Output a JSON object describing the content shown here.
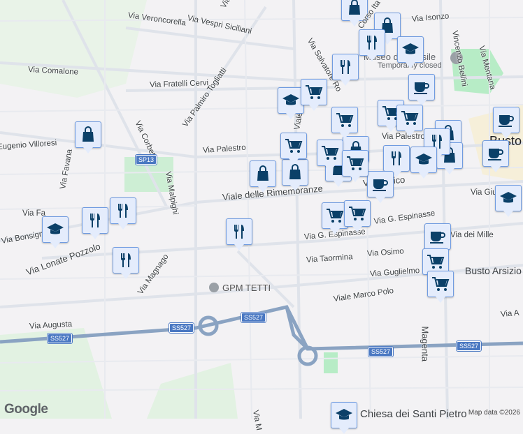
{
  "map": {
    "streets": [
      "Via Tolmino",
      "Via Vespri Siciliani",
      "Via Veroncorella",
      "Via Comalone",
      "Via Fratelli Cervi",
      "Via Palmiro Togliatti",
      "Via Corbetta",
      "Via Palestro",
      "Via Palestro",
      "SP13",
      "Via Favana",
      "Via Malpighi",
      "Viale delle Rimembranze",
      "Via Lonate Pozzolo",
      "Via Bonsignora",
      "Via Magnago",
      "Via G. Espinasse",
      "Via G. Espinasse",
      "Via Taormina",
      "Via Osimo",
      "Via Guglielmo P",
      "Viale Marco Polo",
      "Via Augusta",
      "SS527",
      "SS527",
      "SS527",
      "SS527",
      "Magenta",
      "Via Isonzo",
      "Vincenzo Bellini",
      "Via Mentana",
      "Via Salvatore Ro",
      "Corso Ita",
      "Viale Mo",
      "Via dei Mille",
      "Via Giu",
      "Eugenio Villoresi",
      "Via Fa",
      "Via M",
      "Via Pellico",
      "Via A"
    ],
    "places": {
      "museum": "Museo del Tessile",
      "museum_status": "Temporarily closed",
      "gpm": "GPM TETTI",
      "busto": "Busto Arsizio",
      "busto_top": "Busto",
      "church": "Chiesa dei Santi Pietro"
    },
    "marker_types": [
      "shopping-bag",
      "restaurant",
      "school",
      "cafe",
      "supermarket"
    ],
    "colors": {
      "marker_bg": "#e4ecfc",
      "marker_icon": "#0b4068",
      "highway": "#8aa3c2",
      "park": "#b7ecc6"
    },
    "credit": "Map data ©2026",
    "logo": "Google"
  }
}
